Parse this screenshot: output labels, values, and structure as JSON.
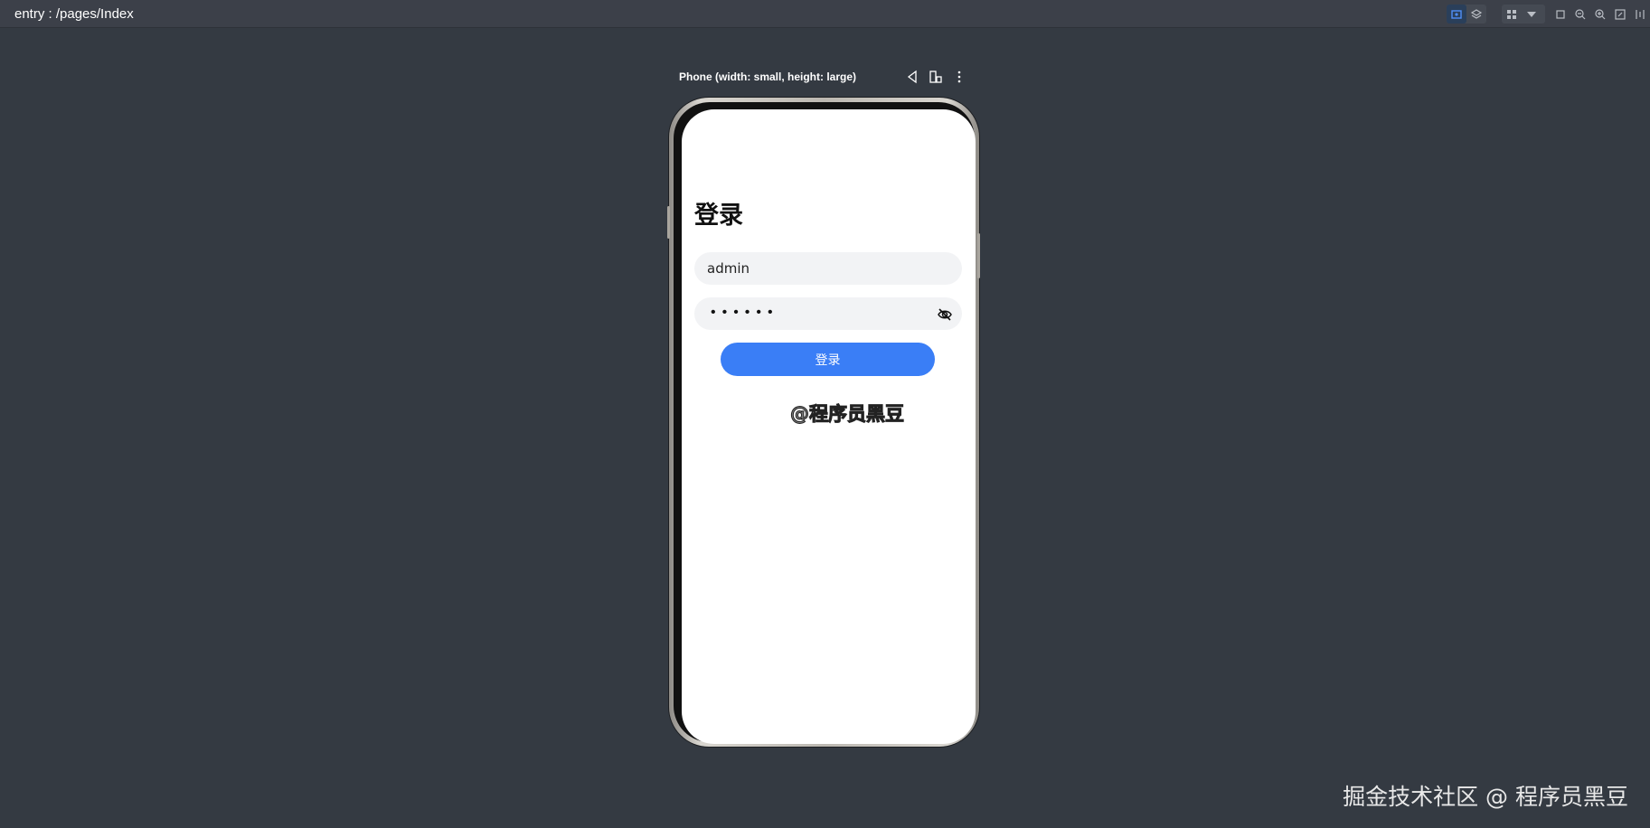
{
  "window": {
    "route": "entry : /pages/Index"
  },
  "device": {
    "label": "Phone (width: small, height: large)"
  },
  "app": {
    "title": "登录",
    "username": {
      "value": "admin",
      "placeholder": ""
    },
    "password": {
      "masked": "••••••",
      "placeholder": ""
    },
    "login_button": "登录"
  },
  "watermark": {
    "center": "@程序员黑豆",
    "corner": "掘金技术社区 @ 程序员黑豆"
  },
  "icons": {
    "inspector": "inspect-icon",
    "layers": "layers-icon",
    "grid": "grid-icon",
    "dropdown": "chevron-down-icon",
    "crop": "crop-icon",
    "zoom_out": "zoom-out-icon",
    "zoom_in": "zoom-in-icon",
    "fit": "fit-screen-icon",
    "ruler": "ruler-icon",
    "rotate": "rotate-icon",
    "fold": "fold-device-icon",
    "more": "more-icon",
    "eye_off": "eye-off-icon"
  },
  "colors": {
    "accent": "#3a7ef6",
    "background": "#343a42",
    "field": "#f2f3f5"
  }
}
